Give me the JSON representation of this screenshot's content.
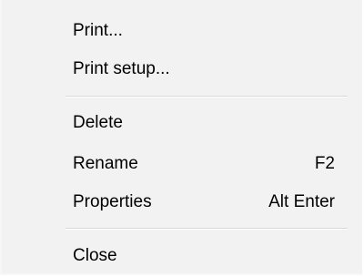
{
  "menu": {
    "items": [
      {
        "label": "Print...",
        "shortcut": ""
      },
      {
        "label": "Print setup...",
        "shortcut": ""
      },
      {
        "label": "Delete",
        "shortcut": ""
      },
      {
        "label": "Rename",
        "shortcut": "F2"
      },
      {
        "label": "Properties",
        "shortcut": "Alt Enter"
      },
      {
        "label": "Close",
        "shortcut": ""
      }
    ]
  }
}
